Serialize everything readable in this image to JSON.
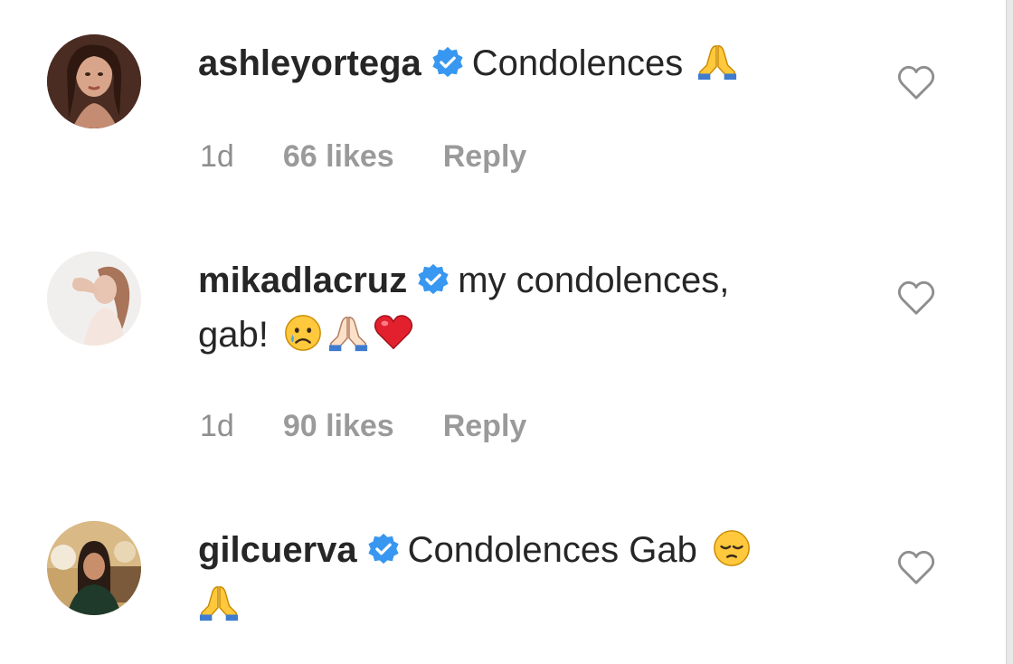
{
  "comments": [
    {
      "username": "ashleyortega",
      "text": "Condolences",
      "time": "1d",
      "likes": "66 likes",
      "reply": "Reply",
      "emojis": [
        "folded-hands-icon"
      ]
    },
    {
      "username": "mikadlacruz",
      "text": "my condolences,",
      "text2": "gab!",
      "time": "1d",
      "likes": "90 likes",
      "reply": "Reply",
      "emojis": [
        "crying-face-icon",
        "folded-hands-light-icon",
        "red-heart-icon"
      ]
    },
    {
      "username": "gilcuerva",
      "text": "Condolences Gab",
      "emojis": [
        "pensive-face-icon",
        "folded-hands-icon"
      ]
    }
  ],
  "colors": {
    "text": "#262626",
    "meta": "#8e8e8e",
    "verified": "#3897f0",
    "heart_outline": "#8e8e8e"
  }
}
